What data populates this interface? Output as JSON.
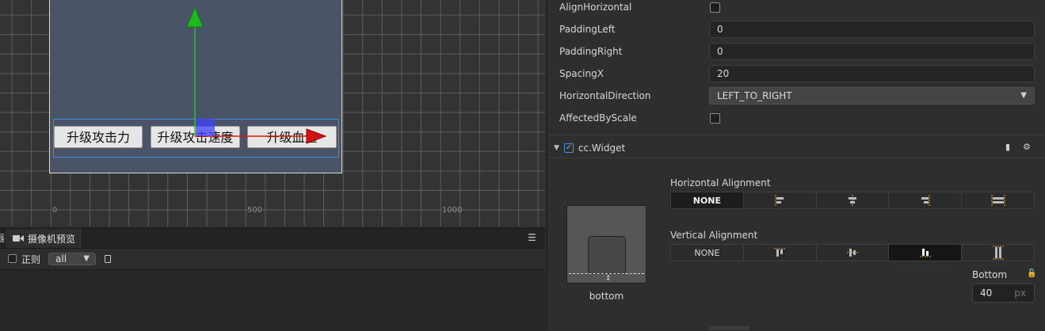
{
  "scene": {
    "buttons": [
      "升级攻击力",
      "升级攻击速度",
      "升级血量"
    ],
    "ruler_labels": [
      "0",
      "500",
      "1000"
    ]
  },
  "console": {
    "left_tab_char": "器",
    "tab_label": "摄像机预览",
    "regex_label": "正则",
    "filter_value": "all"
  },
  "inspector": {
    "props": [
      {
        "label": "AlignHorizontal",
        "type": "checkbox",
        "checked": false
      },
      {
        "label": "PaddingLeft",
        "type": "number",
        "value": "0"
      },
      {
        "label": "PaddingRight",
        "type": "number",
        "value": "0"
      },
      {
        "label": "SpacingX",
        "type": "number",
        "value": "20"
      },
      {
        "label": "HorizontalDirection",
        "type": "select",
        "value": "LEFT_TO_RIGHT"
      },
      {
        "label": "AffectedByScale",
        "type": "checkbox",
        "checked": false
      }
    ],
    "component": {
      "title": "cc.Widget",
      "enabled": true
    },
    "widget": {
      "preview_caption": "bottom",
      "horizontal_title": "Horizontal Alignment",
      "horizontal_none": "NONE",
      "vertical_title": "Vertical Alignment",
      "vertical_none": "NONE",
      "vertical_selected": "bottom",
      "bottom_label": "Bottom",
      "bottom_value": "40",
      "bottom_unit": "px"
    }
  },
  "colors": {
    "accent_blue": "#3a8de0",
    "axis_green": "#29c129",
    "axis_red": "#e01515",
    "handle_blue": "#4040ff",
    "canvas_fill": "#4b5467"
  }
}
